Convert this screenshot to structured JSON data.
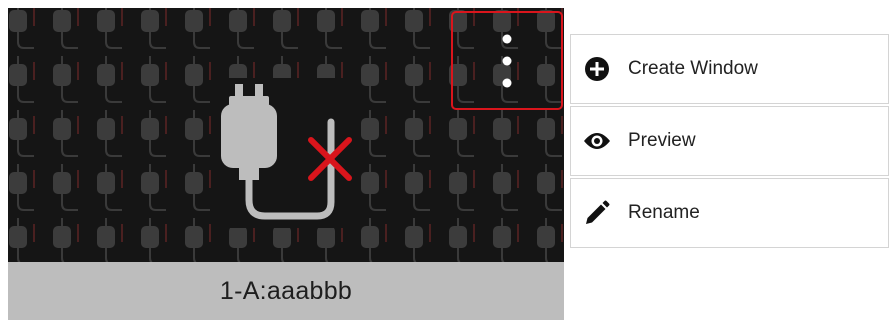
{
  "source_tile": {
    "caption": "1-A:aaabbb",
    "status": "disconnected",
    "status_icon": "cable-disconnected-icon",
    "more_button_icon": "more-vertical-icon"
  },
  "context_menu": {
    "items": [
      {
        "label": "Create Window",
        "icon": "plus-circle-icon"
      },
      {
        "label": "Preview",
        "icon": "eye-icon"
      },
      {
        "label": "Rename",
        "icon": "pencil-icon"
      }
    ]
  },
  "colors": {
    "highlight": "#d9151c",
    "disconnect_mark": "#d9151c",
    "preview_bg": "#151515",
    "caption_bg": "#bdbdbd"
  }
}
